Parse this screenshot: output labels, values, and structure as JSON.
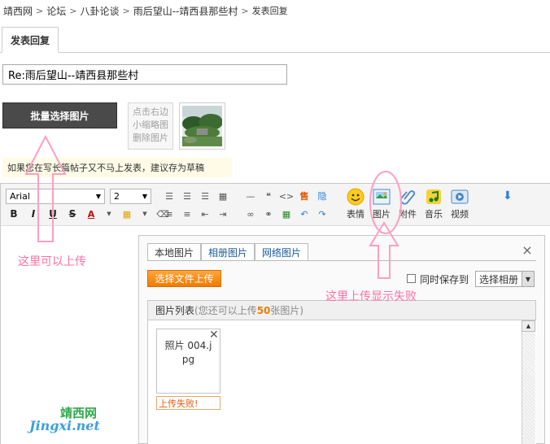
{
  "breadcrumb": [
    "靖西网",
    "论坛",
    "八卦论谈",
    "雨后望山--靖西县那些村",
    "发表回复"
  ],
  "tab": {
    "label": "发表回复"
  },
  "subject": {
    "value": "Re:雨后望山--靖西县那些村"
  },
  "upload": {
    "batch_label": "批量选择图片",
    "thumb_hint": [
      "点击右边",
      "小缩略图",
      "删除图片"
    ]
  },
  "draft_notice": "如果您在写长篇帖子又不马上发表，建议存为草稿",
  "toolbar": {
    "font": "Arial",
    "size": "2",
    "format_buttons": [
      "B",
      "I",
      "U",
      "S"
    ],
    "big_buttons": [
      {
        "icon": "smiley-icon",
        "label": "表情"
      },
      {
        "icon": "image-icon",
        "label": "图片"
      },
      {
        "icon": "paperclip-icon",
        "label": "附件"
      },
      {
        "icon": "music-icon",
        "label": "音乐"
      },
      {
        "icon": "video-icon",
        "label": "视频"
      }
    ]
  },
  "image_dialog": {
    "tabs": [
      "本地图片",
      "相册图片",
      "网络图片"
    ],
    "close": "×",
    "upload_button": "选择文件上传",
    "save_label": "同时保存到",
    "album_select": "选择相册",
    "list_title": "图片列表",
    "list_hint_pre": "(您还可以上传",
    "list_hint_num": "50",
    "list_hint_post": "张图片)",
    "file": {
      "name_line1": "照片 004.j",
      "name_line2": "pg",
      "status": "上传失败!"
    }
  },
  "annotations": {
    "left_note": "这里可以上传",
    "right_note": "这里上传显示失败",
    "watermark_cn": "靖西网",
    "watermark_en": "Jingxi.net"
  },
  "colors": {
    "annotation": "#ff6fa6",
    "upload_button": "#f07b00",
    "fail_text": "#e8590c",
    "batch_button": "#4a4a4a"
  }
}
